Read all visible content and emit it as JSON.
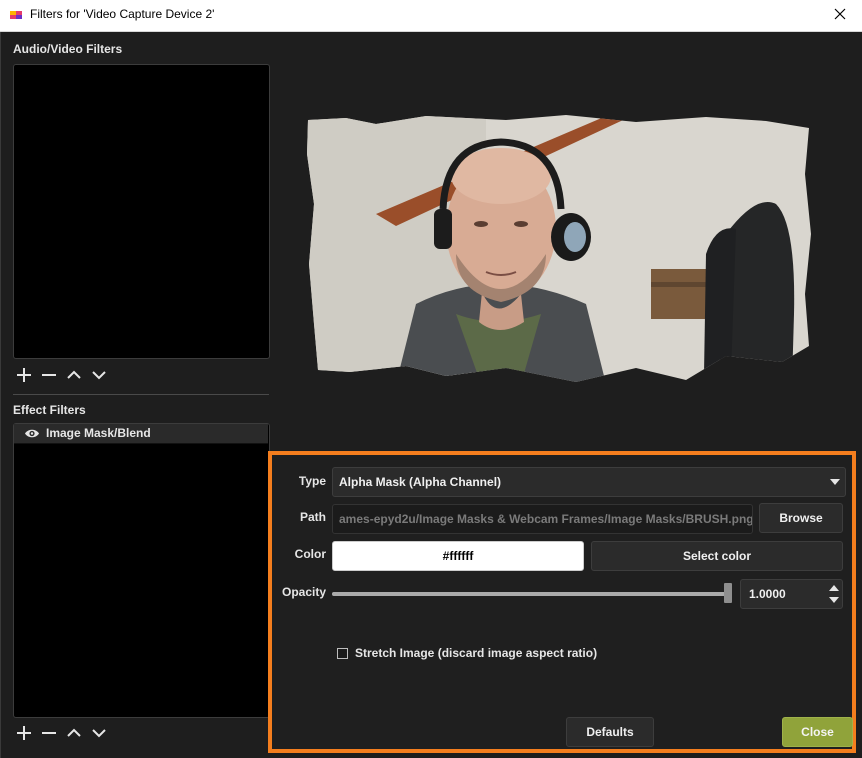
{
  "window": {
    "title": "Filters for 'Video Capture Device 2'",
    "app_icon": "obs-app-icon",
    "close_icon": "close-icon"
  },
  "audio_video_filters": {
    "label": "Audio/Video Filters",
    "items": [],
    "toolbar_icons": [
      "plus-icon",
      "minus-icon",
      "chevron-up-icon",
      "chevron-down-icon"
    ]
  },
  "effect_filters": {
    "label": "Effect Filters",
    "items": [
      {
        "label": "Image Mask/Blend",
        "visibility_icon": "eye-icon"
      }
    ],
    "toolbar_icons": [
      "plus-icon",
      "minus-icon",
      "chevron-up-icon",
      "chevron-down-icon"
    ]
  },
  "properties": {
    "type": {
      "label": "Type",
      "value": "Alpha Mask (Alpha Channel)"
    },
    "path": {
      "label": "Path",
      "value": "ames-epyd2u/Image Masks & Webcam Frames/Image Masks/BRUSH.png",
      "browse_label": "Browse"
    },
    "color": {
      "label": "Color",
      "value": "#ffffff",
      "select_label": "Select color"
    },
    "opacity": {
      "label": "Opacity",
      "value": "1.0000",
      "level": 1.0
    },
    "stretch": {
      "label": "Stretch Image (discard image aspect ratio)",
      "checked": false
    }
  },
  "buttons": {
    "defaults": "Defaults",
    "close": "Close"
  },
  "colors": {
    "highlight_border": "#f47e1e",
    "close_button": "#90a33a",
    "background": "#1e1e1e"
  }
}
